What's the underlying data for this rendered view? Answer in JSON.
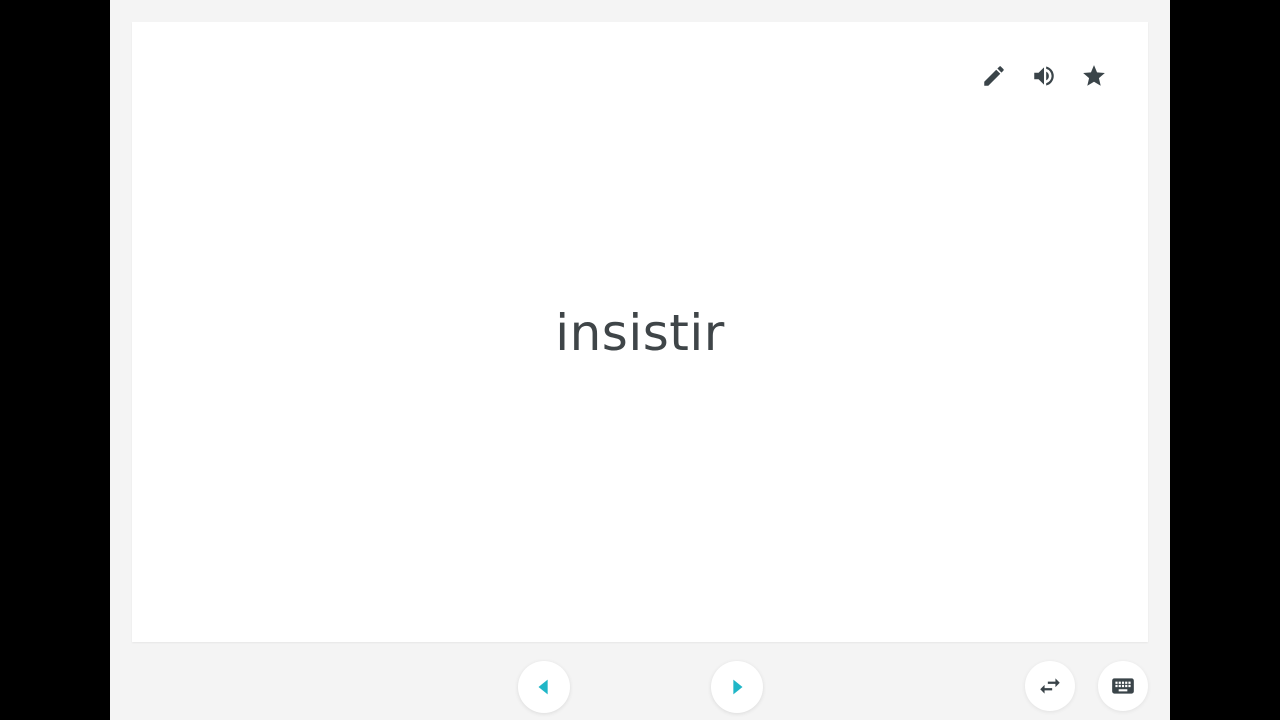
{
  "card": {
    "term": "insistir",
    "tools": [
      {
        "name": "edit",
        "icon": "pencil-icon"
      },
      {
        "name": "audio",
        "icon": "speaker-icon"
      },
      {
        "name": "star",
        "icon": "star-icon"
      }
    ]
  },
  "navigation": {
    "previous_icon": "chevron-left-icon",
    "next_icon": "chevron-right-icon",
    "accent_color": "#1fb6c7"
  },
  "utilities": {
    "swap_icon": "swap-arrows-icon",
    "keyboard_icon": "keyboard-icon"
  },
  "colors": {
    "background": "#000000",
    "stage": "#f4f4f4",
    "card": "#ffffff",
    "text": "#3f4548",
    "icon": "#3a4449"
  }
}
